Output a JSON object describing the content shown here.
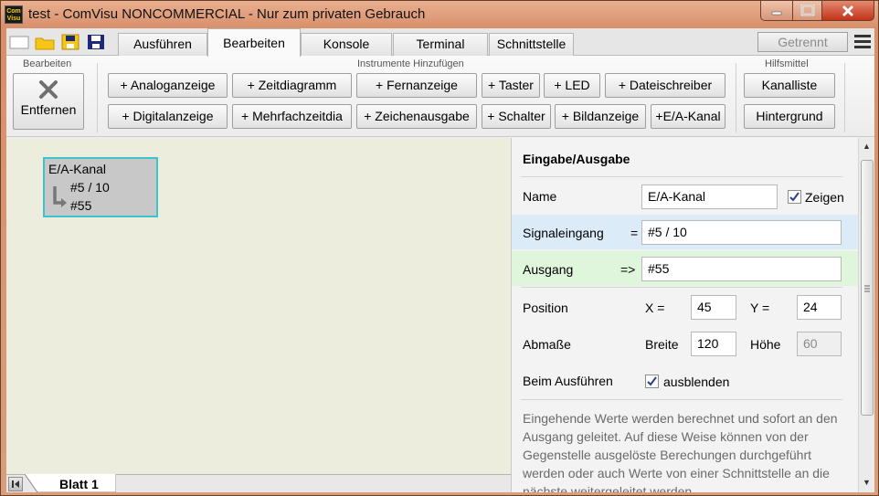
{
  "window": {
    "app_icon_text": "Com Visu",
    "title": "test - ComVisu NONCOMMERCIAL - Nur zum privaten Gebrauch"
  },
  "quick_icons": [
    "new-file-icon",
    "open-folder-icon",
    "save-icon",
    "save-as-icon"
  ],
  "tabs": [
    {
      "label": "Ausführen",
      "active": false
    },
    {
      "label": "Bearbeiten",
      "active": true
    },
    {
      "label": "Konsole",
      "active": false
    },
    {
      "label": "Terminal",
      "active": false
    },
    {
      "label": "Schnittstelle",
      "active": false
    }
  ],
  "connection_status": "Getrennt",
  "ribbon": {
    "edit_group": {
      "label": "Bearbeiten",
      "remove_label": "Entfernen"
    },
    "instruments_group": {
      "label": "Instrumente Hinzufügen",
      "row1": [
        "+ Analoganzeige",
        "+ Zeitdiagramm",
        "+ Fernanzeige",
        "+ Taster",
        "+ LED",
        "+ Dateischreiber"
      ],
      "row2": [
        "+ Digitalanzeige",
        "+ Mehrfachzeitdia",
        "+ Zeichenausgabe",
        "+ Schalter",
        "+ Bildanzeige",
        "+E/A-Kanal"
      ]
    },
    "tools_group": {
      "label": "Hilfsmittel",
      "channel_list": "Kanalliste",
      "background": "Hintergrund"
    }
  },
  "widget": {
    "title": "E/A-Kanal",
    "input": "#5 / 10",
    "output": "#55"
  },
  "panel": {
    "heading": "Eingabe/Ausgabe",
    "name_label": "Name",
    "name_value": "E/A-Kanal",
    "show_label": "Zeigen",
    "show_checked": true,
    "signal_label": "Signaleingang",
    "signal_op": "=",
    "signal_value": "#5 / 10",
    "output_label": "Ausgang",
    "output_op": "=>",
    "output_value": "#55",
    "position_label": "Position",
    "x_label": "X =",
    "x_value": "45",
    "y_label": "Y =",
    "y_value": "24",
    "size_label": "Abmaße",
    "width_label": "Breite",
    "width_value": "120",
    "height_label": "Höhe",
    "height_value": "60",
    "run_label": "Beim Ausführen",
    "hide_label": "ausblenden",
    "hide_checked": true,
    "description": "Eingehende Werte werden berechnet und sofort an den Ausgang geleitet. Auf diese Weise können von der Gegenstelle ausgelöste Berechungen durchgeführt werden oder auch Werte von einer Schnittstelle an die nächste weitergeleitet werden."
  },
  "sheet": {
    "label": "Blatt 1"
  },
  "colors": {
    "signal_row_bg": "#dcebf8",
    "output_row_bg": "#dff5dc",
    "widget_border": "#3cc3cc",
    "canvas_bg": "#ededdd",
    "titlebar": "#d99e7a"
  }
}
